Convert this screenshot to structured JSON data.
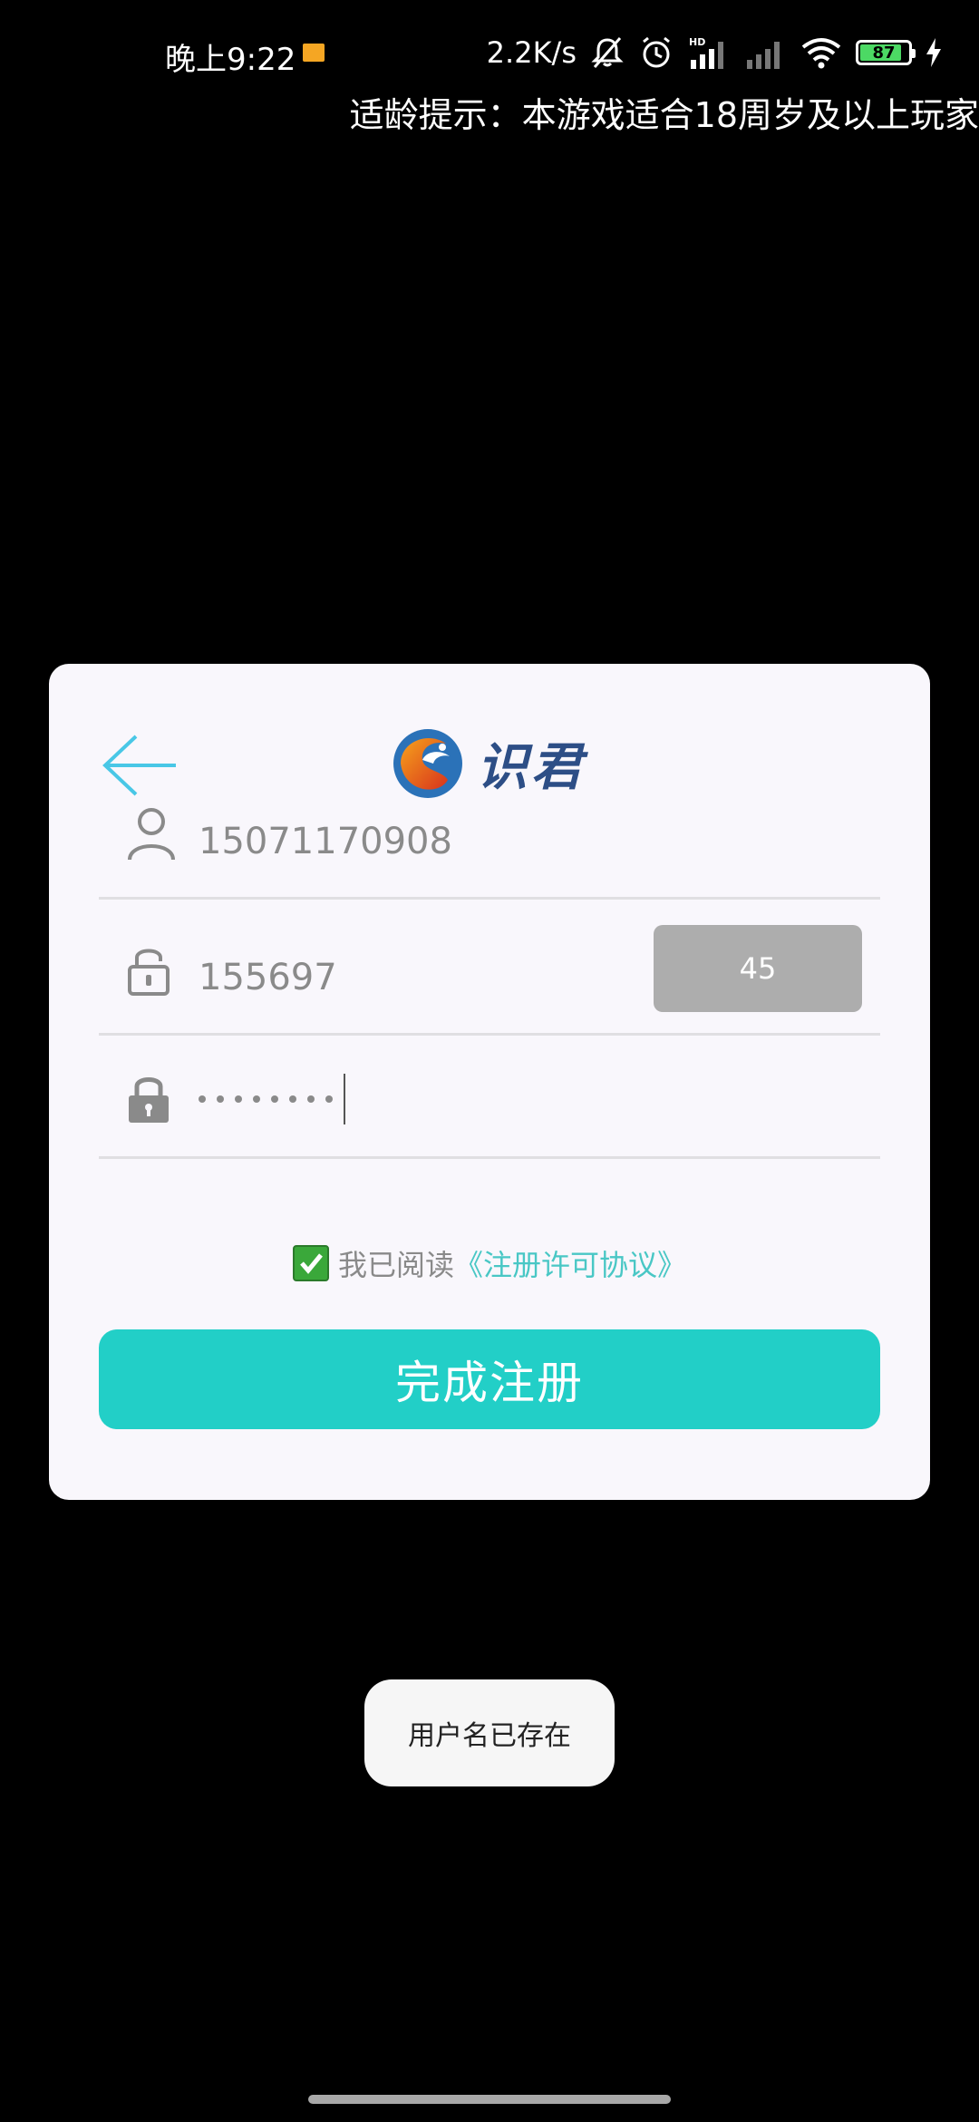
{
  "status_bar": {
    "time": "晚上9:22",
    "net_speed": "2.2K/s",
    "battery_level": "87",
    "battery_fraction": 0.87,
    "icons": [
      "notification-icon",
      "mute-icon",
      "alarm-icon",
      "signal-icon",
      "signal-weak-icon",
      "wifi-icon",
      "battery-icon",
      "charging-icon"
    ]
  },
  "age_notice": "适龄提示：本游戏适合18周岁及以上玩家",
  "card": {
    "logo_text": "识君",
    "username": {
      "value": "15071170908",
      "icon": "user-icon"
    },
    "code": {
      "value": "155697",
      "icon": "lock-open-icon",
      "countdown_label": "45"
    },
    "password": {
      "masked_length": 8,
      "icon": "lock-icon"
    },
    "agreement": {
      "prefix": "我已阅读",
      "link": "《注册许可协议》",
      "checked": true
    },
    "submit_label": "完成注册"
  },
  "toast": "用户名已存在",
  "colors": {
    "accent": "#22cfc7",
    "link": "#49c7c5",
    "card_bg": "#f9f7fc",
    "countdown_bg": "#adadad"
  }
}
